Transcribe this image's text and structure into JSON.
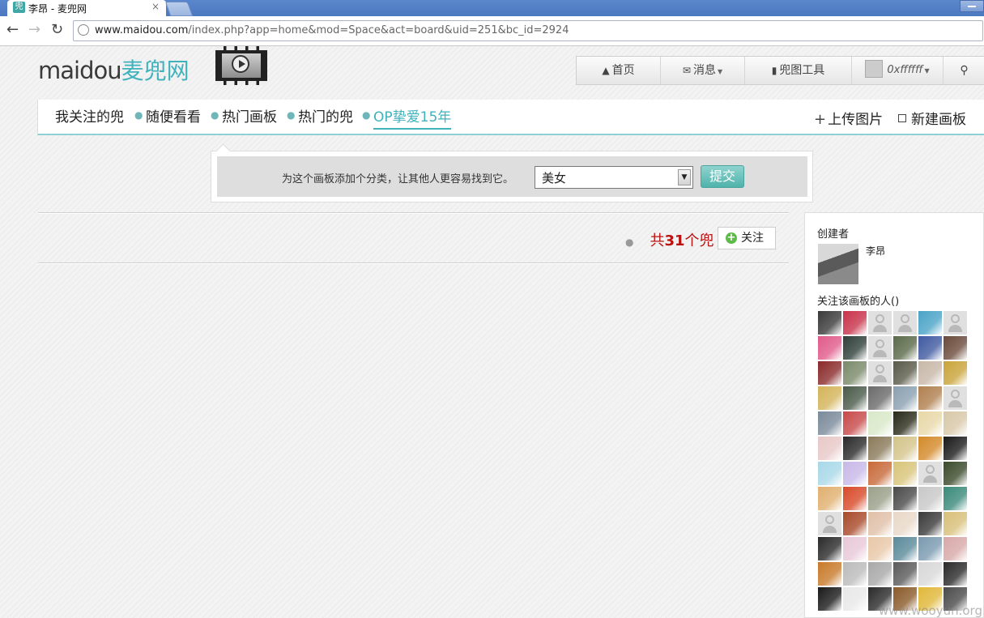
{
  "browser": {
    "tab_title": "李昂 - 麦兜网",
    "favicon": "兜",
    "close": "×",
    "url_host": "www.maidou.com",
    "url_path": "/index.php?app=home&mod=Space&act=board&uid=251&bc_id=2924"
  },
  "header": {
    "logo_latin": "maidou",
    "logo_cn": "麦兜网",
    "menu": {
      "home": "首页",
      "messages": "消息",
      "tools": "兜图工具",
      "user": "0xffffff"
    }
  },
  "subnav": {
    "items": [
      "我关注的兜",
      "随便看看",
      "热门画板",
      "热门的兜",
      "OP挚爱15年"
    ],
    "upload": "上传图片",
    "new_board": "新建画板"
  },
  "category": {
    "prompt": "为这个画板添加个分类，让其他人更容易找到它。",
    "selected": "美女",
    "submit": "提交"
  },
  "board": {
    "count_prefix": "共",
    "count": "31",
    "count_suffix": "个兜",
    "follow": "关注"
  },
  "sidebar": {
    "creator_heading": "创建者",
    "creator_name": "李昂",
    "followers_heading": "关注该画板的人()"
  },
  "watermark": "www.wooyun.org",
  "colors": {
    "accent": "#3fb2bc",
    "count_red": "#bb1111",
    "follow_green": "#5fba4a"
  }
}
